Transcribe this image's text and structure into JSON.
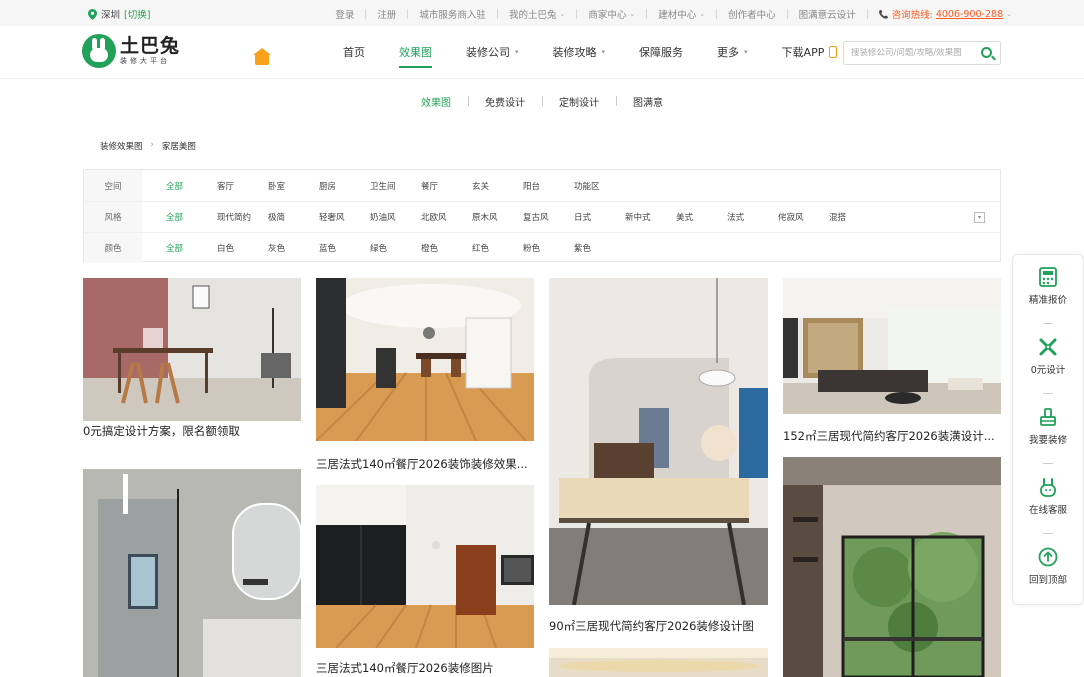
{
  "topbar": {
    "city": "深圳",
    "switch": "[切换]",
    "links": [
      {
        "label": "登录",
        "caret": false
      },
      {
        "label": "注册",
        "caret": false
      },
      {
        "label": "城市服务商入驻",
        "caret": false
      },
      {
        "label": "我的土巴兔",
        "caret": true
      },
      {
        "label": "商家中心",
        "caret": true
      },
      {
        "label": "建材中心",
        "caret": true
      },
      {
        "label": "创作者中心",
        "caret": false
      },
      {
        "label": "图满意云设计",
        "caret": false
      }
    ],
    "hotline_label": "咨询热线:",
    "hotline_number": "4006-900-288"
  },
  "header": {
    "logo_main": "土巴兔",
    "logo_sub": "装修大平台",
    "nav": [
      {
        "label": "首页",
        "caret": false,
        "active": false
      },
      {
        "label": "效果图",
        "caret": false,
        "active": true
      },
      {
        "label": "装修公司",
        "caret": true,
        "active": false
      },
      {
        "label": "装修攻略",
        "caret": true,
        "active": false
      },
      {
        "label": "保障服务",
        "caret": false,
        "active": false
      },
      {
        "label": "更多",
        "caret": true,
        "active": false
      },
      {
        "label": "下载APP",
        "caret": false,
        "active": false
      }
    ],
    "search_placeholder": "搜装修公司/问题/攻略/效果图"
  },
  "subnav": [
    {
      "label": "效果图",
      "active": true
    },
    {
      "label": "免费设计",
      "active": false
    },
    {
      "label": "定制设计",
      "active": false
    },
    {
      "label": "图满意",
      "active": false
    }
  ],
  "breadcrumb": [
    "装修效果图",
    "家居美图"
  ],
  "filters": [
    {
      "label": "空间",
      "options": [
        "全部",
        "客厅",
        "卧室",
        "厨房",
        "卫生间",
        "餐厅",
        "玄关",
        "阳台",
        "功能区"
      ]
    },
    {
      "label": "风格",
      "options": [
        "全部",
        "现代简约",
        "极简",
        "轻奢风",
        "奶油风",
        "北欧风",
        "原木风",
        "复古风",
        "日式",
        "新中式",
        "美式",
        "法式",
        "侘寂风",
        "混搭"
      ]
    },
    {
      "label": "颜色",
      "options": [
        "全部",
        "白色",
        "灰色",
        "蓝色",
        "绿色",
        "橙色",
        "红色",
        "粉色",
        "紫色"
      ]
    }
  ],
  "cards": [
    {
      "caption": "0元搞定设计方案，限名额领取"
    },
    {
      "caption": "三居法式140㎡餐厅2026装饰装修效果..."
    },
    {
      "caption": "90㎡三居现代简约客厅2026装修设计图"
    },
    {
      "caption": "152㎡三居现代简约客厅2026装潢设计..."
    },
    {
      "caption": ""
    },
    {
      "caption": "三居法式140㎡餐厅2026装修图片"
    },
    {
      "caption": ""
    },
    {
      "caption": ""
    }
  ],
  "side": [
    "精准报价",
    "0元设计",
    "我要装修",
    "在线客服",
    "回到顶部"
  ],
  "colors": {
    "brand": "#21a15a",
    "hot": "#ff5a1f",
    "accent": "#f7a21a"
  }
}
